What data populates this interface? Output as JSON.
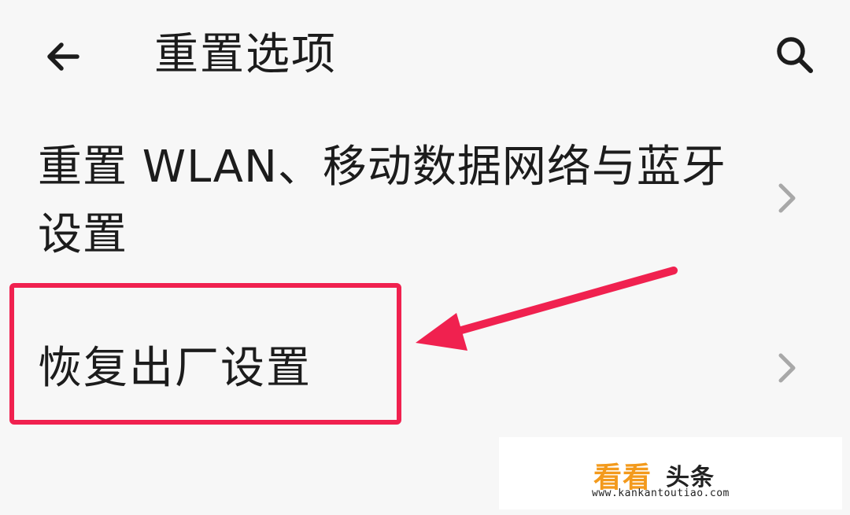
{
  "header": {
    "title": "重置选项",
    "back_icon": "arrow-left-icon",
    "search_icon": "search-icon"
  },
  "items": [
    {
      "label": "重置 WLAN、移动数据网络与蓝牙设置",
      "icon": "chevron-right-icon"
    },
    {
      "label": "恢复出厂设置",
      "icon": "chevron-right-icon"
    }
  ],
  "annotation": {
    "highlight_color": "#f0214f",
    "target": "恢复出厂设置"
  },
  "watermark": {
    "brand_a": "看看",
    "brand_b": "头条",
    "url": "www.kankantoutiao.com",
    "brand_color": "#f39a1c"
  }
}
